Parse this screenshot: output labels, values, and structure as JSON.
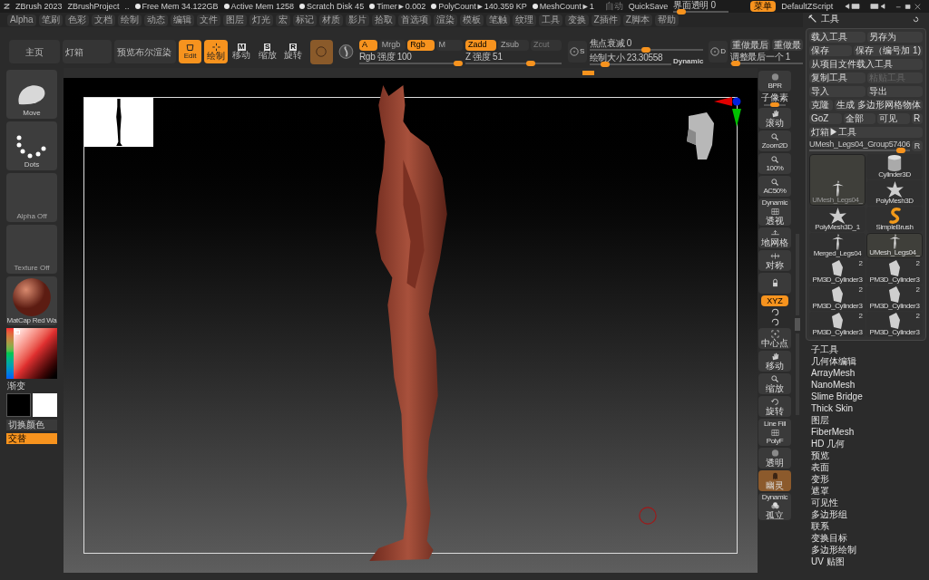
{
  "title_bar": {
    "app": "ZBrush 2023",
    "project": "ZBrushProject",
    "ellipsis": "..",
    "stats": [
      "Free Mem 34.122GB",
      "Active Mem 1258",
      "Scratch Disk 45",
      "Timer►0.002",
      "PolyCount►140.359 KP",
      "MeshCount►1"
    ],
    "auto": {
      "label": "自动",
      "disabled": true
    },
    "quicksave": "QuickSave",
    "transparency": {
      "label": "界面透明 0",
      "level": 0.08
    },
    "menu_button": {
      "label": "菜单",
      "selected": true
    },
    "script": "DefaultZScript"
  },
  "menu_bar": [
    "Alpha",
    "笔刷",
    "色彩",
    "文档",
    "绘制",
    "动态",
    "编辑",
    "文件",
    "图层",
    "灯光",
    "宏",
    "标记",
    "材质",
    "影片",
    "拾取",
    "首选项",
    "渲染",
    "模板",
    "笔触",
    "纹理",
    "工具",
    "变换",
    "Z插件",
    "Z脚本",
    "帮助"
  ],
  "palette_title": "工具",
  "toolbar": {
    "nav": [
      "主页",
      "灯箱",
      "预览布尔渲染"
    ],
    "modes": [
      {
        "kind": "edit",
        "label": "Edit",
        "selected": true
      },
      {
        "kind": "draw",
        "label": "绘制",
        "selected": true
      },
      {
        "kind": "key",
        "key": "M",
        "label": "移动",
        "selected": false
      },
      {
        "kind": "key",
        "key": "S",
        "label": "缩放",
        "selected": false
      },
      {
        "kind": "key",
        "key": "R",
        "label": "旋转",
        "selected": false
      }
    ],
    "color_channels": [
      {
        "label": "A",
        "selected": true
      },
      {
        "label": "Mrgb",
        "selected": false
      },
      {
        "label": "Rgb",
        "selected": true
      },
      {
        "label": "M",
        "selected": false
      }
    ],
    "depth_modes": [
      {
        "label": "Zadd",
        "selected": true,
        "disabled": false
      },
      {
        "label": "Zsub",
        "selected": false,
        "disabled": false
      },
      {
        "label": "Zcut",
        "selected": false,
        "disabled": true
      }
    ],
    "rgb_intensity": {
      "label": "Rgb 强度 100",
      "level": 1
    },
    "z_intensity": {
      "label": "Z 强度 51",
      "level": 0.7
    },
    "stroke_s": "S",
    "focal_shift": {
      "label": "焦点衰减 0",
      "level": 0.5
    },
    "draw_size": {
      "label": "绘制大小 23.30558",
      "level": 0.15
    },
    "dynamic": "Dynamic",
    "stroke_d": "D",
    "redo": [
      "重做最后",
      "重做最"
    ],
    "tweak_last": {
      "label": "调整最后一个 1",
      "level": 0.02
    }
  },
  "left_column": {
    "brush": "Move",
    "stroke": "Dots",
    "alpha": "Alpha Off",
    "texture": "Texture Off",
    "material": "MatCap Red Wa",
    "gradient": "渐变",
    "switch_color": "切换颜色",
    "alternate": {
      "label": "交替",
      "selected": true
    }
  },
  "shelf": [
    {
      "kind": "sphere",
      "label": "BPR",
      "selected": false
    },
    {
      "kind": "slider",
      "label": "子像素",
      "level": 0.5
    },
    {
      "kind": "hand",
      "label": "滚动",
      "selected": false
    },
    {
      "kind": "zoom",
      "label": "Zoom2D",
      "selected": false
    },
    {
      "kind": "zoom",
      "label": "100%",
      "selected": false
    },
    {
      "kind": "zoom",
      "label": "AC50%",
      "selected": false
    },
    {
      "kind": "grid",
      "top": "Dynamic",
      "label": "透视",
      "selected": false
    },
    {
      "kind": "floor",
      "label": "地网格",
      "selected": false
    },
    {
      "kind": "sym",
      "label": "对称",
      "selected": false
    },
    {
      "kind": "lock",
      "selected": false
    },
    {
      "kind": "pill",
      "label": "XYZ",
      "selected": true
    },
    {
      "kind": "mini"
    },
    {
      "kind": "mini"
    },
    {
      "kind": "frame",
      "label": "中心点",
      "selected": false
    },
    {
      "kind": "hand",
      "label": "移动",
      "selected": false
    },
    {
      "kind": "zoom",
      "label": "缩放",
      "selected": false
    },
    {
      "kind": "rotate",
      "label": "旋转",
      "selected": false
    },
    {
      "kind": "grid",
      "top": "Line Fill",
      "label": "PolyF",
      "selected": false
    },
    {
      "kind": "sphere",
      "label": "透明",
      "selected": false
    },
    {
      "kind": "ghost",
      "label": "幽灵",
      "selected": true
    },
    {
      "kind": "spheres",
      "top": "Dynamic",
      "label": "孤立",
      "selected": false
    }
  ],
  "tool_panel": {
    "rows": [
      [
        {
          "label": "载入工具",
          "disabled": false
        },
        {
          "label": "另存为",
          "disabled": false
        }
      ],
      [
        {
          "label": "保存",
          "disabled": false
        },
        {
          "label": "保存（编号加 1)",
          "disabled": false
        }
      ],
      [
        {
          "label": "从项目文件载入工具",
          "disabled": false
        }
      ],
      [
        {
          "label": "复制工具",
          "disabled": false
        },
        {
          "label": "粘贴工具",
          "disabled": true
        }
      ],
      [
        {
          "label": "导入",
          "disabled": false
        },
        {
          "label": "导出",
          "disabled": false
        }
      ],
      [
        {
          "label": "克隆",
          "disabled": false
        },
        {
          "label": "生成 多边形网格物体",
          "disabled": false
        }
      ],
      [
        {
          "label": "GoZ",
          "disabled": false
        },
        {
          "label": "全部",
          "disabled": false
        },
        {
          "label": "可见",
          "disabled": false
        },
        {
          "label": "R",
          "disabled": false
        }
      ],
      [
        {
          "label": "灯箱▶工具",
          "disabled": false
        }
      ]
    ],
    "current_tool": {
      "label": "UMesh_Legs04_Group57406",
      "level": 0.95
    },
    "current_r": "R",
    "tools": [
      {
        "kind": "cylinder",
        "name": "Cylinder3D",
        "large": false,
        "selected": false
      },
      {
        "kind": "figure",
        "name": "UMesh_Legs04_",
        "large": true,
        "selected": true
      },
      {
        "kind": "star",
        "name": "PolyMesh3D",
        "large": false,
        "selected": false
      },
      {
        "kind": "star",
        "name": "PolyMesh3D_1",
        "large": false,
        "selected": false
      },
      {
        "kind": "brush",
        "name": "SimpleBrush",
        "large": false,
        "selected": false
      },
      {
        "kind": "figure",
        "name": "Merged_Legs04",
        "large": false,
        "selected": false
      },
      {
        "kind": "figure",
        "name": "UMesh_Legs04_",
        "large": false,
        "selected": true
      },
      {
        "kind": "piece",
        "name": "PM3D_Cylinder3",
        "count": "2",
        "large": false,
        "selected": false
      },
      {
        "kind": "piece",
        "name": "PM3D_Cylinder3",
        "count": "2",
        "large": false,
        "selected": false
      },
      {
        "kind": "piece",
        "name": "PM3D_Cylinder3",
        "count": "2",
        "large": false,
        "selected": false
      },
      {
        "kind": "piece",
        "name": "PM3D_Cylinder3",
        "count": "2",
        "large": false,
        "selected": false
      },
      {
        "kind": "piece",
        "name": "PM3D_Cylinder3",
        "count": "2",
        "large": false,
        "selected": false
      },
      {
        "kind": "piece",
        "name": "PM3D_Cylinder3",
        "count": "2",
        "large": false,
        "selected": false
      }
    ]
  },
  "subpalettes": [
    "子工具",
    "几何体编辑",
    "ArrayMesh",
    "NanoMesh",
    "Slime Bridge",
    "Thick Skin",
    "图层",
    "FiberMesh",
    "HD 几何",
    "预览",
    "表面",
    "变形",
    "遮罩",
    "可见性",
    "多边形组",
    "联系",
    "变换目标",
    "多边形绘制",
    "UV 贴图"
  ]
}
